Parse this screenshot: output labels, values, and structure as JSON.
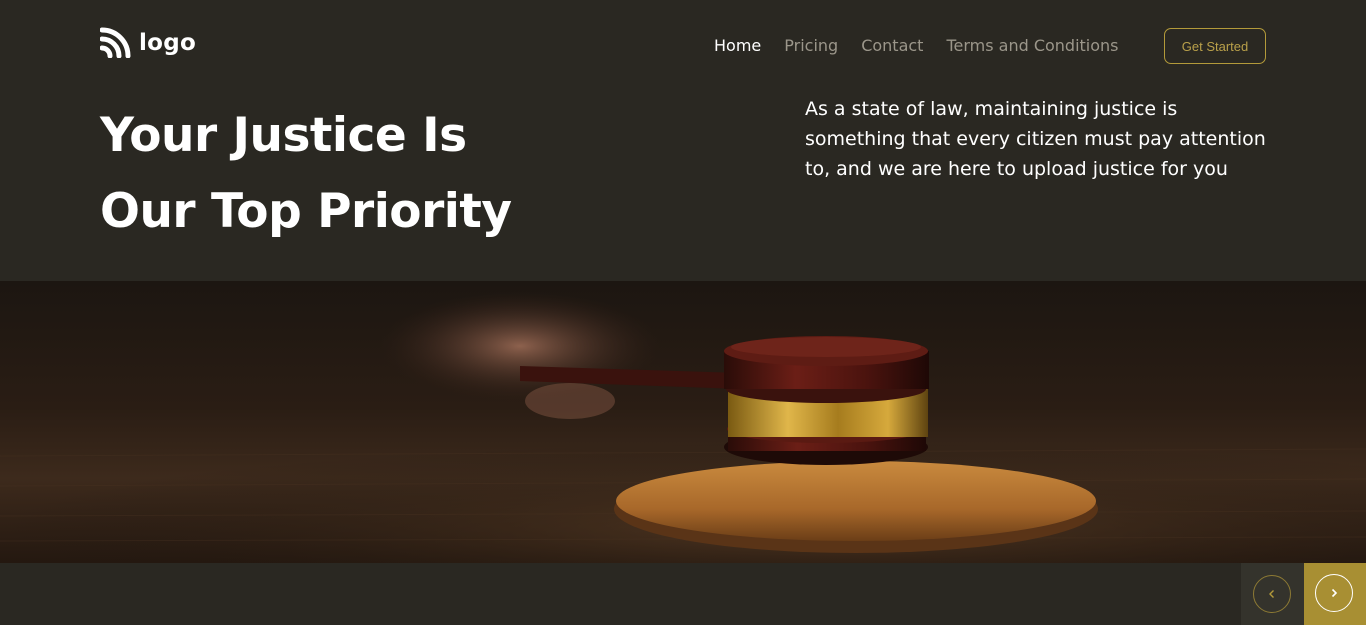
{
  "header": {
    "logo_text": "logo",
    "nav": [
      {
        "label": "Home",
        "active": true
      },
      {
        "label": "Pricing",
        "active": false
      },
      {
        "label": "Contact",
        "active": false
      },
      {
        "label": "Terms and Conditions",
        "active": false
      }
    ],
    "cta_label": "Get Started"
  },
  "hero": {
    "headline_line1": "Your Justice Is",
    "headline_line2": "Our Top Priority",
    "description": "As a state of law, maintaining justice is something that every citizen must pay attention to, and we are here to upload justice for you"
  },
  "slider": {
    "prev_icon": "chevron-left-icon",
    "next_icon": "chevron-right-icon"
  },
  "colors": {
    "background": "#2a2822",
    "accent": "#a88f33",
    "text": "#ffffff",
    "muted": "#9b968a"
  }
}
